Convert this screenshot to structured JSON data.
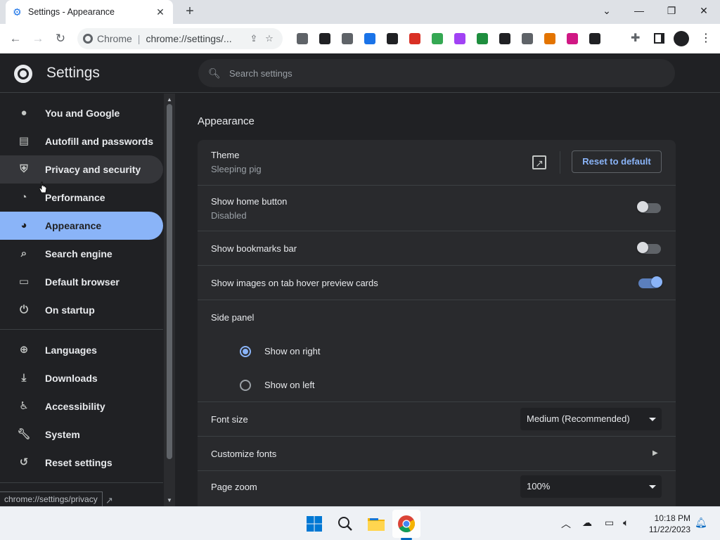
{
  "browser": {
    "tab_title": "Settings - Appearance",
    "tab_close": "✕",
    "new_tab": "+",
    "window_controls": [
      "⌄",
      "—",
      "❐",
      "✕"
    ],
    "omnibox_site": "Chrome",
    "omnibox_url": "chrome://settings/...",
    "extension_colors": [
      "#5f6368",
      "#202124",
      "#5f6368",
      "#1a73e8",
      "#202124",
      "#d93025",
      "#34a853",
      "#a142f4",
      "#1e8e3e",
      "#202124",
      "#5f6368",
      "#e37400",
      "#d01884",
      "#202124"
    ]
  },
  "header": {
    "title": "Settings",
    "search_placeholder": "Search settings"
  },
  "sidebar": {
    "items": [
      {
        "label": "You and Google",
        "icon": "person-icon"
      },
      {
        "label": "Autofill and passwords",
        "icon": "clipboard-icon"
      },
      {
        "label": "Privacy and security",
        "icon": "shield-icon"
      },
      {
        "label": "Performance",
        "icon": "speedometer-icon"
      },
      {
        "label": "Appearance",
        "icon": "palette-icon"
      },
      {
        "label": "Search engine",
        "icon": "search-icon"
      },
      {
        "label": "Default browser",
        "icon": "browser-icon"
      },
      {
        "label": "On startup",
        "icon": "power-icon"
      },
      {
        "label": "Languages",
        "icon": "globe-icon"
      },
      {
        "label": "Downloads",
        "icon": "download-icon"
      },
      {
        "label": "Accessibility",
        "icon": "accessibility-icon"
      },
      {
        "label": "System",
        "icon": "wrench-icon"
      },
      {
        "label": "Reset settings",
        "icon": "reset-icon"
      }
    ],
    "status_link": "chrome://settings/privacy"
  },
  "main": {
    "section_title": "Appearance",
    "theme": {
      "label": "Theme",
      "value": "Sleeping pig",
      "reset_label": "Reset to default"
    },
    "home_button": {
      "label": "Show home button",
      "value": "Disabled",
      "on": false
    },
    "bookmarks_bar": {
      "label": "Show bookmarks bar",
      "on": false
    },
    "tab_hover": {
      "label": "Show images on tab hover preview cards",
      "on": true
    },
    "side_panel": {
      "label": "Side panel",
      "options": [
        "Show on right",
        "Show on left"
      ],
      "selected": "Show on right"
    },
    "font_size": {
      "label": "Font size",
      "value": "Medium (Recommended)"
    },
    "customize_fonts": {
      "label": "Customize fonts"
    },
    "page_zoom": {
      "label": "Page zoom",
      "value": "100%"
    }
  },
  "taskbar": {
    "time": "10:18 PM",
    "date": "11/22/2023"
  },
  "colors": {
    "accent": "#8ab4f8",
    "background": "#202124",
    "card": "#292a2d"
  }
}
